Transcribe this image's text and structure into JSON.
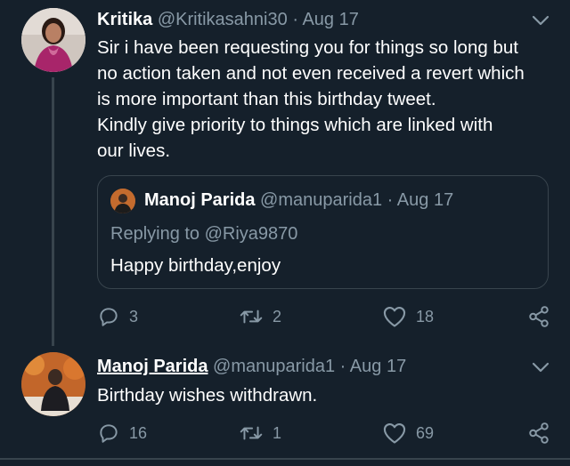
{
  "tweets": [
    {
      "name": "Kritika",
      "handle": "@Kritikasahni30",
      "separator": "·",
      "date": "Aug 17",
      "text_lines": [
        "Sir i have been requesting you for things so long but",
        "no action taken and not even received a revert which",
        "is more important than this birthday tweet.",
        "Kindly give priority to things which are linked with",
        "our lives."
      ],
      "quoted": {
        "name": "Manoj Parida",
        "handle": "@manuparida1",
        "separator": "·",
        "date": "Aug 17",
        "replying_to": "Replying to @Riya9870",
        "text": "Happy birthday,enjoy"
      },
      "replies": "3",
      "retweets": "2",
      "likes": "18"
    },
    {
      "name": "Manoj Parida",
      "handle": "@manuparida1",
      "separator": "·",
      "date": "Aug 17",
      "text_lines": [
        "Birthday wishes withdrawn."
      ],
      "replies": "16",
      "retweets": "1",
      "likes": "69"
    }
  ],
  "icons": {
    "reply": "reply-icon",
    "retweet": "retweet-icon",
    "like": "heart-icon",
    "share": "share-icon",
    "more": "chevron-down-icon"
  },
  "colors": {
    "background": "#15202b",
    "secondary_text": "#8899a6",
    "border": "#38444d"
  }
}
